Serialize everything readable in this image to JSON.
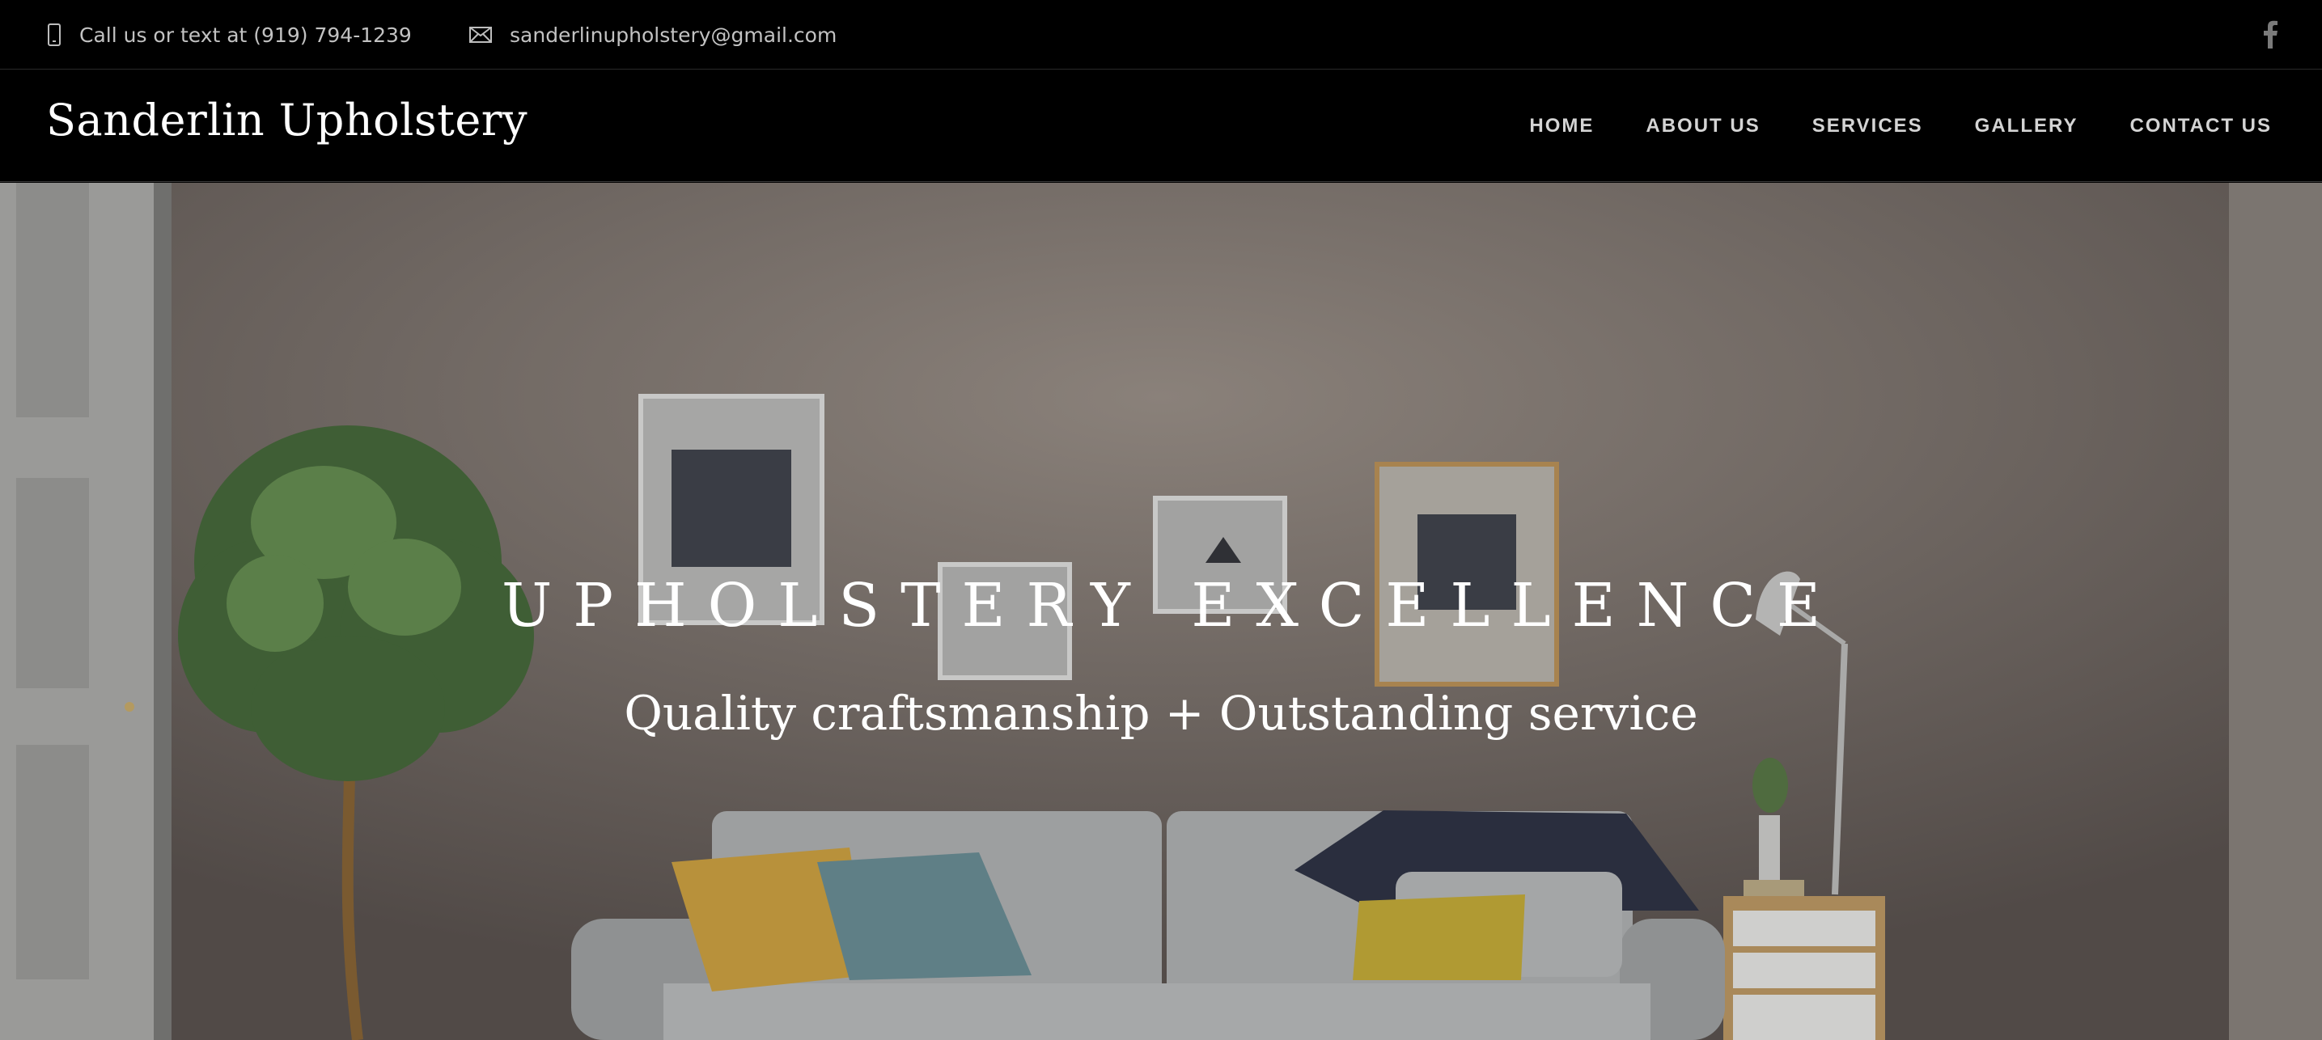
{
  "topbar": {
    "phone_icon": "phone-icon",
    "phone_text": "Call us or text at (919) 794-1239",
    "email_icon": "envelope-icon",
    "email_text": "sanderlinupholstery@gmail.com",
    "social_icon": "facebook-icon"
  },
  "header": {
    "brand": "Sanderlin Upholstery",
    "nav": [
      {
        "label": "HOME"
      },
      {
        "label": "ABOUT US"
      },
      {
        "label": "SERVICES"
      },
      {
        "label": "GALLERY"
      },
      {
        "label": "CONTACT US"
      }
    ]
  },
  "hero": {
    "title": "UPHOLSTERY EXCELLENCE",
    "subtitle": "Quality craftsmanship + Outstanding service"
  },
  "colors": {
    "background": "#000000",
    "text": "#ffffff",
    "muted_text": "#c2c2c2",
    "hero_overlay": "#5f5852"
  }
}
